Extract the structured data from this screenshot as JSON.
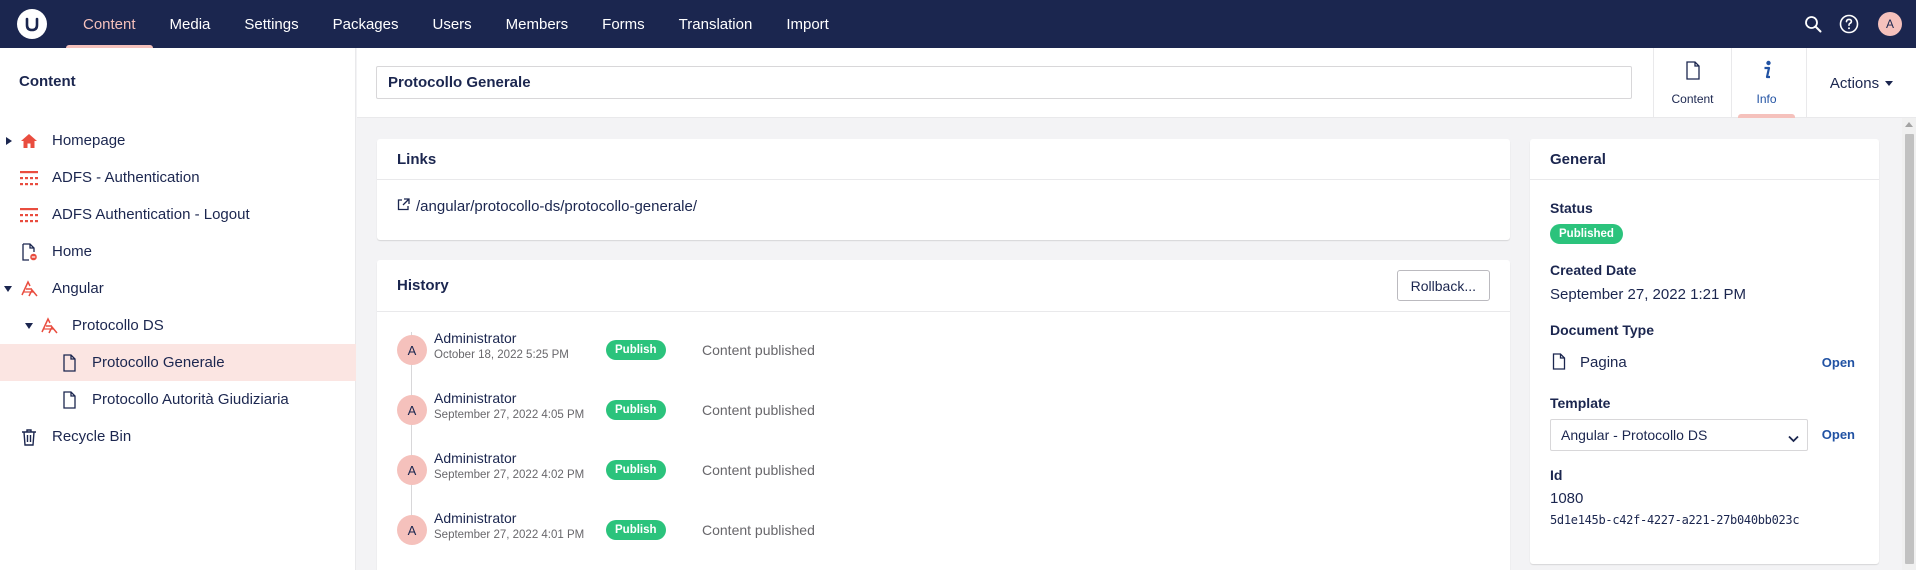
{
  "topnav": {
    "logo_icon": "umbraco-logo-icon",
    "items": [
      "Content",
      "Media",
      "Settings",
      "Packages",
      "Users",
      "Members",
      "Forms",
      "Translation",
      "Import"
    ],
    "active_index": 0,
    "avatar_initial": "A"
  },
  "sidebar": {
    "title": "Content",
    "tree": [
      {
        "label": "Homepage",
        "icon": "home-icon",
        "has_caret": "right",
        "level": 0
      },
      {
        "label": "ADFS - Authentication",
        "icon": "grid-dots-icon",
        "has_caret": "",
        "level": 0
      },
      {
        "label": "ADFS Authentication - Logout",
        "icon": "grid-dots-icon",
        "has_caret": "",
        "level": 0
      },
      {
        "label": "Home",
        "icon": "document-unpublished-icon",
        "has_caret": "",
        "level": 0
      },
      {
        "label": "Angular",
        "icon": "angular-icon",
        "has_caret": "down",
        "level": 0
      },
      {
        "label": "Protocollo DS",
        "icon": "angular-icon",
        "has_caret": "down",
        "level": 1
      },
      {
        "label": "Protocollo Generale",
        "icon": "document-icon",
        "has_caret": "",
        "level": 2,
        "selected": true
      },
      {
        "label": "Protocollo Autorità Giudiziaria",
        "icon": "document-icon",
        "has_caret": "",
        "level": 2
      },
      {
        "label": "Recycle Bin",
        "icon": "trash-icon",
        "has_caret": "",
        "level": 0
      }
    ]
  },
  "header": {
    "name_value": "Protocollo Generale",
    "tabs": [
      {
        "label": "Content",
        "icon": "document-icon"
      },
      {
        "label": "Info",
        "icon": "info-icon"
      }
    ],
    "active_tab": 1,
    "actions_label": "Actions"
  },
  "links": {
    "title": "Links",
    "url": "/angular/protocollo-ds/protocollo-generale/"
  },
  "history": {
    "title": "History",
    "rollback_label": "Rollback...",
    "entries": [
      {
        "initial": "A",
        "user": "Administrator",
        "date": "October 18, 2022 5:25 PM",
        "badge": "Publish",
        "message": "Content published"
      },
      {
        "initial": "A",
        "user": "Administrator",
        "date": "September 27, 2022 4:05 PM",
        "badge": "Publish",
        "message": "Content published"
      },
      {
        "initial": "A",
        "user": "Administrator",
        "date": "September 27, 2022 4:02 PM",
        "badge": "Publish",
        "message": "Content published"
      },
      {
        "initial": "A",
        "user": "Administrator",
        "date": "September 27, 2022 4:01 PM",
        "badge": "Publish",
        "message": "Content published"
      }
    ]
  },
  "general": {
    "title": "General",
    "status_label": "Status",
    "status_value": "Published",
    "created_label": "Created Date",
    "created_value": "September 27, 2022 1:21 PM",
    "doctype_label": "Document Type",
    "doctype_value": "Pagina",
    "open_label": "Open",
    "template_label": "Template",
    "template_value": "Angular - Protocollo DS",
    "id_label": "Id",
    "id_value": "1080",
    "guid_value": "5d1e145b-c42f-4227-a221-27b040bb023c"
  },
  "colors": {
    "nav_bg": "#1b264f",
    "accent": "#f5c1bc",
    "success": "#2bc37c",
    "selected_bg": "#fbe5e2",
    "link_blue": "#2152a3",
    "icon_red": "#e94d3f"
  }
}
